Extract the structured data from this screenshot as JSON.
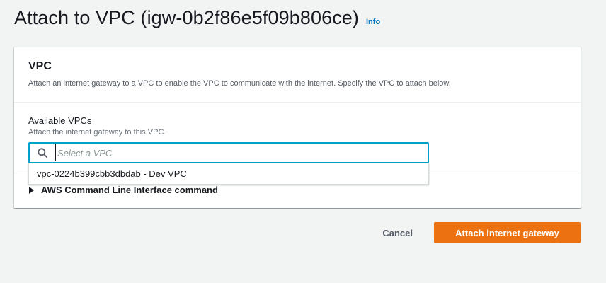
{
  "header": {
    "title": "Attach to VPC (igw-0b2f86e5f09b806ce)",
    "info_label": "Info"
  },
  "panel": {
    "title": "VPC",
    "description": "Attach an internet gateway to a VPC to enable the VPC to communicate with the internet. Specify the VPC to attach below.",
    "field": {
      "label": "Available VPCs",
      "description": "Attach the internet gateway to this VPC.",
      "placeholder": "Select a VPC",
      "value": ""
    },
    "dropdown_options": [
      "vpc-0224b399cbb3dbdab - Dev VPC"
    ],
    "cli_section_label": "AWS Command Line Interface command"
  },
  "actions": {
    "cancel_label": "Cancel",
    "primary_label": "Attach internet gateway"
  },
  "colors": {
    "accent": "#ec7211",
    "link": "#0073bb",
    "focus_border": "#00a1c9"
  },
  "icons": {
    "search": "search-icon",
    "caret": "caret-right-icon"
  }
}
